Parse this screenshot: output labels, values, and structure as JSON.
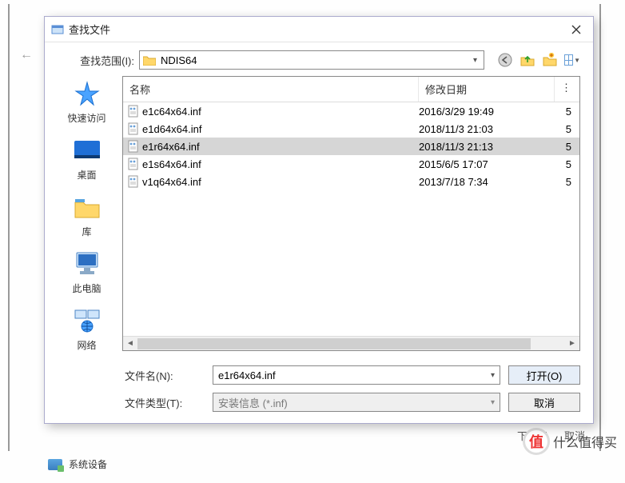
{
  "background": {
    "next_label": "下一步",
    "cancel_label": "取消",
    "system_devices_label": "系统设备",
    "watermark_char": "值",
    "watermark_text": "什么值得买"
  },
  "dialog": {
    "title": "查找文件",
    "lookin_label": "查找范围(I):",
    "lookin_value": "NDIS64",
    "columns": {
      "name": "名称",
      "date": "修改日期",
      "more": "⋮"
    },
    "files": [
      {
        "name": "e1c64x64.inf",
        "date": "2016/3/29 19:49",
        "more": "5",
        "selected": false
      },
      {
        "name": "e1d64x64.inf",
        "date": "2018/11/3 21:03",
        "more": "5",
        "selected": false
      },
      {
        "name": "e1r64x64.inf",
        "date": "2018/11/3 21:13",
        "more": "5",
        "selected": true
      },
      {
        "name": "e1s64x64.inf",
        "date": "2015/6/5 17:07",
        "more": "5",
        "selected": false
      },
      {
        "name": "v1q64x64.inf",
        "date": "2013/7/18 7:34",
        "more": "5",
        "selected": false
      }
    ],
    "places": [
      {
        "key": "quick",
        "label": "快速访问"
      },
      {
        "key": "desktop",
        "label": "桌面"
      },
      {
        "key": "library",
        "label": "库"
      },
      {
        "key": "thispc",
        "label": "此电脑"
      },
      {
        "key": "network",
        "label": "网络"
      }
    ],
    "filename_label": "文件名(N):",
    "filename_value": "e1r64x64.inf",
    "filetype_label": "文件类型(T):",
    "filetype_value": "安装信息 (*.inf)",
    "open_label": "打开(O)",
    "cancel_label": "取消"
  }
}
